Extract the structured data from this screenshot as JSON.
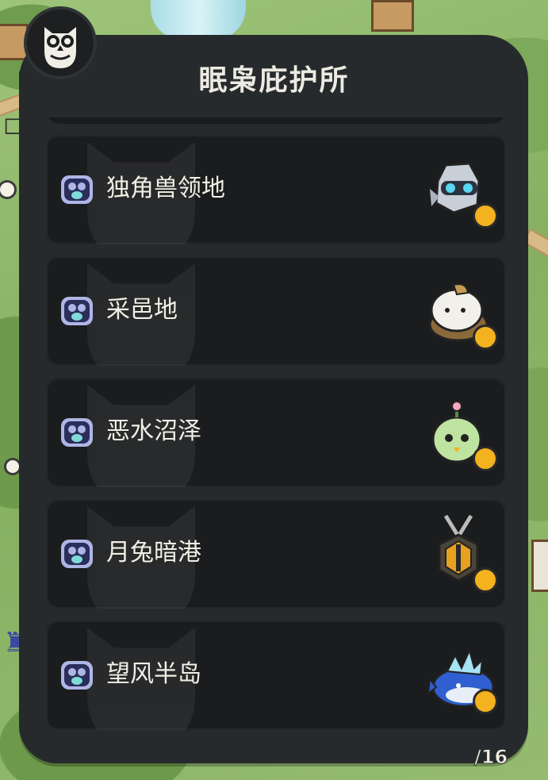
{
  "panel": {
    "title": "眠枭庇护所"
  },
  "sanctuaries": [
    {
      "label": "独角兽领地",
      "creature_icon": "robot-mask-creature-icon"
    },
    {
      "label": "采邑地",
      "creature_icon": "snail-shell-creature-icon"
    },
    {
      "label": "恶水沼泽",
      "creature_icon": "green-sprout-creature-icon"
    },
    {
      "label": "月兔暗港",
      "creature_icon": "winged-shield-creature-icon"
    },
    {
      "label": "望风半岛",
      "creature_icon": "ice-crystal-fish-creature-icon"
    }
  ],
  "map": {
    "page_indicator": "/16"
  },
  "colors": {
    "panel": "#262a2c",
    "row": "#1b1c1d",
    "text": "#f2efe6",
    "bell": "#f3b21e",
    "badge": "#aeb6e6"
  }
}
